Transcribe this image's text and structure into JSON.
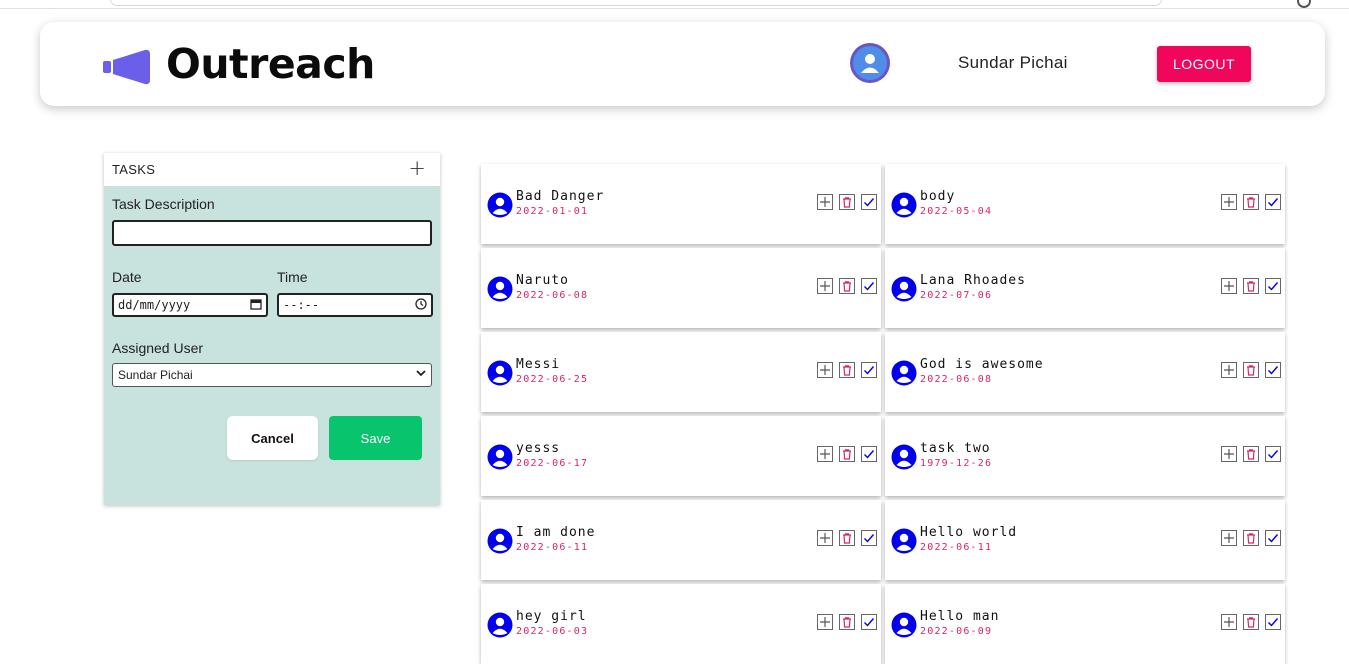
{
  "app": {
    "name": "Outreach",
    "accent": "#6b5ee8",
    "logout_color": "#f0065a",
    "save_color": "#07c46d",
    "form_bg": "#c8e3dd",
    "date_color": "#e0245e",
    "user_icon_color": "#0000ee"
  },
  "header": {
    "logo_icon": "megaphone-icon",
    "logo_text": "Outreach",
    "avatar_icon": "user-avatar-icon",
    "username": "Sundar Pichai",
    "logout_label": "LOGOUT"
  },
  "form": {
    "section_title": "TASKS",
    "add_icon": "plus-icon",
    "task_description_label": "Task Description",
    "task_description_value": "",
    "date_label": "Date",
    "date_placeholder": "dd/mm/yyyy",
    "time_label": "Time",
    "time_placeholder": "--:--",
    "assigned_user_label": "Assigned User",
    "assigned_user_value": "Sundar Pichai",
    "cancel_label": "Cancel",
    "save_label": "Save"
  },
  "tasks": [
    {
      "name": "Bad Danger",
      "date": "2022-01-01"
    },
    {
      "name": "body",
      "date": "2022-05-04"
    },
    {
      "name": "Naruto",
      "date": "2022-06-08"
    },
    {
      "name": "Lana Rhoades",
      "date": "2022-07-06"
    },
    {
      "name": "Messi",
      "date": "2022-06-25"
    },
    {
      "name": "God is awesome",
      "date": "2022-06-08"
    },
    {
      "name": "yesss",
      "date": "2022-06-17"
    },
    {
      "name": "task two",
      "date": "1979-12-26"
    },
    {
      "name": "I am done",
      "date": "2022-06-11"
    },
    {
      "name": "Hello world",
      "date": "2022-06-11"
    },
    {
      "name": "hey girl",
      "date": "2022-06-03"
    },
    {
      "name": "Hello man",
      "date": "2022-06-09"
    }
  ]
}
